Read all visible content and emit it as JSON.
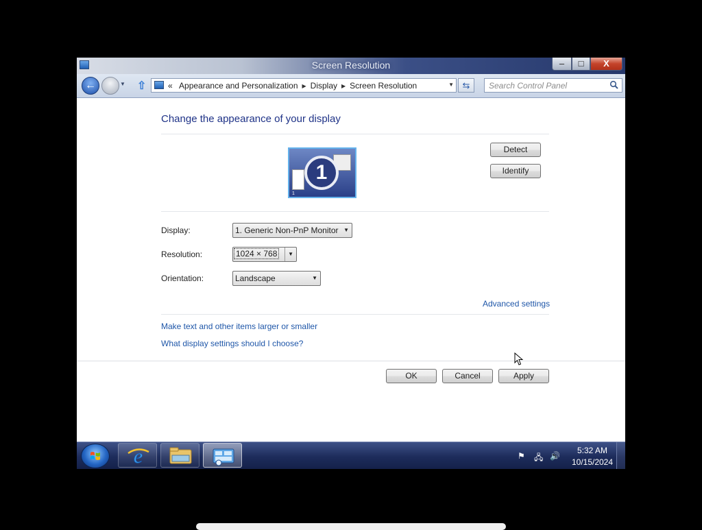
{
  "window": {
    "title": "Screen Resolution",
    "controls": {
      "minimize": "–",
      "maximize": "□",
      "close": "X"
    }
  },
  "navbar": {
    "address_prefix": "«",
    "breadcrumbs": [
      "Appearance and Personalization",
      "Display",
      "Screen Resolution"
    ],
    "search_placeholder": "Search Control Panel"
  },
  "content": {
    "title": "Change the appearance of your display",
    "monitor_number": "1",
    "monitor_small_label": "1",
    "detect_label": "Detect",
    "identify_label": "Identify",
    "fields": {
      "display": {
        "label": "Display:",
        "value": "1. Generic Non-PnP Monitor"
      },
      "resolution": {
        "label": "Resolution:",
        "value": "1024 × 768"
      },
      "orientation": {
        "label": "Orientation:",
        "value": "Landscape"
      }
    },
    "advanced_link": "Advanced settings",
    "links": [
      "Make text and other items larger or smaller",
      "What display settings should I choose?"
    ],
    "buttons": {
      "ok": "OK",
      "cancel": "Cancel",
      "apply": "Apply"
    }
  },
  "taskbar": {
    "items": [
      "start-button",
      "internet-explorer",
      "windows-explorer",
      "display-control-panel"
    ],
    "tray_icons": [
      "flag-icon",
      "network-icon",
      "volume-icon"
    ],
    "clock": {
      "time": "5:32 AM",
      "date": "10/15/2024"
    }
  },
  "colors": {
    "link": "#1e56a8",
    "heading": "#1e3287",
    "taskbar": "#1d2c5b"
  }
}
